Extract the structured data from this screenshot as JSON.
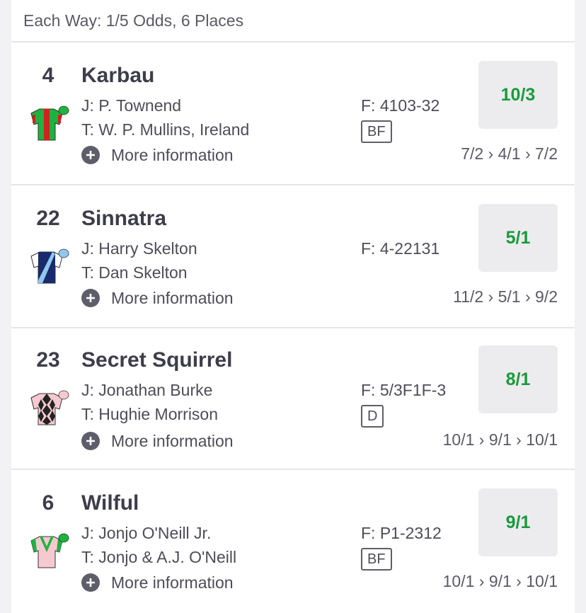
{
  "each_way": "Each Way: 1/5 Odds, 6 Places",
  "runners": [
    {
      "number": "4",
      "name": "Karbau",
      "jockey": "J: P. Townend",
      "trainer": "T: W. P. Mullins, Ireland",
      "form": "F: 4103-32",
      "badge": "BF",
      "odds": "10/3",
      "history": "7/2 › 4/1 › 7/2",
      "more": "More information",
      "silks": "green-red-stripe-silks-icon"
    },
    {
      "number": "22",
      "name": "Sinnatra",
      "jockey": "J: Harry Skelton",
      "trainer": "T: Dan Skelton",
      "form": "F: 4-22131",
      "badge": "",
      "odds": "5/1",
      "history": "11/2 › 5/1 › 9/2",
      "more": "More information",
      "silks": "navy-white-sash-silks-icon"
    },
    {
      "number": "23",
      "name": "Secret Squirrel",
      "jockey": "J: Jonathan Burke",
      "trainer": "T: Hughie Morrison",
      "form": "F: 5/3F1F-3",
      "badge": "D",
      "odds": "8/1",
      "history": "10/1 › 9/1 › 10/1",
      "more": "More information",
      "silks": "pink-black-diamonds-silks-icon"
    },
    {
      "number": "6",
      "name": "Wilful",
      "jockey": "J: Jonjo O'Neill Jr.",
      "trainer": "T: Jonjo & A.J. O'Neill",
      "form": "F: P1-2312",
      "badge": "BF",
      "odds": "9/1",
      "history": "10/1 › 9/1 › 10/1",
      "more": "More information",
      "silks": "pink-green-chevron-silks-icon"
    }
  ],
  "colors": {
    "odds": "#1a9a3a",
    "text": "#3d3d4a",
    "button_bg": "#ececef"
  }
}
